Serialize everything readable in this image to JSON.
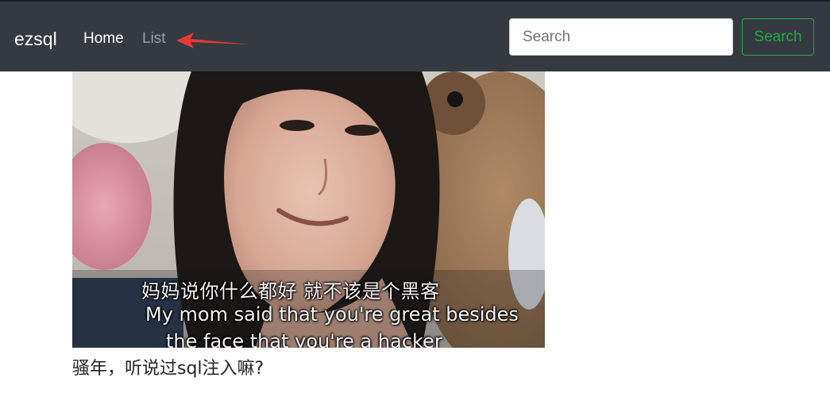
{
  "navbar": {
    "brand": "ezsql",
    "links": [
      {
        "label": "Home",
        "active": true
      },
      {
        "label": "List",
        "active": false
      }
    ],
    "search": {
      "placeholder": "Search",
      "button_label": "Search"
    }
  },
  "annotation": {
    "icon": "red-arrow-icon",
    "color": "#e53935"
  },
  "meme": {
    "caption_zh": "妈妈说你什么都好 就不该是个黑客",
    "caption_en_line1": "My mom said that you're great besides",
    "caption_en_line2": "the face that you're a hacker"
  },
  "main": {
    "question": "骚年，听说过sql注入嘛?"
  },
  "colors": {
    "navbar_bg": "#343a40",
    "success": "#28a745"
  }
}
